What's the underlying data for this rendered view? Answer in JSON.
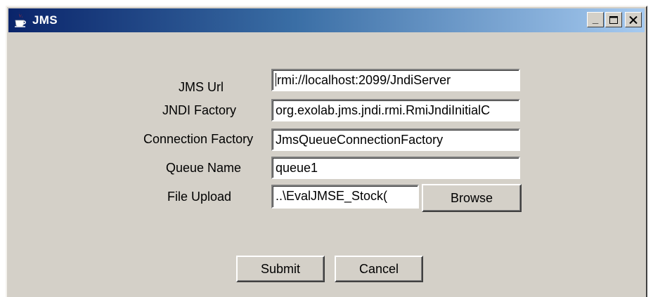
{
  "window": {
    "title": "JMS",
    "title_icon": "java-coffee-cup-icon",
    "controls": {
      "minimize_glyph": "_",
      "maximize_glyph": "□",
      "close_glyph": "✕"
    }
  },
  "form": {
    "jms_url": {
      "label": "JMS Url",
      "value": "rmi://localhost:2099/JndiServer"
    },
    "jndi_factory": {
      "label": "JNDI Factory",
      "value": "org.exolab.jms.jndi.rmi.RmiJndiInitialC"
    },
    "connection_factory": {
      "label": "Connection Factory",
      "value": "JmsQueueConnectionFactory"
    },
    "queue_name": {
      "label": "Queue Name",
      "value": "queue1"
    },
    "file_upload": {
      "label": "File Upload",
      "value": "..\\EvalJMSE_Stock(",
      "browse_label": "Browse"
    }
  },
  "actions": {
    "submit_label": "Submit",
    "cancel_label": "Cancel"
  },
  "colors": {
    "window_bg": "#d4d0c8",
    "titlebar_start": "#0a246a",
    "titlebar_end": "#a6caf0"
  }
}
